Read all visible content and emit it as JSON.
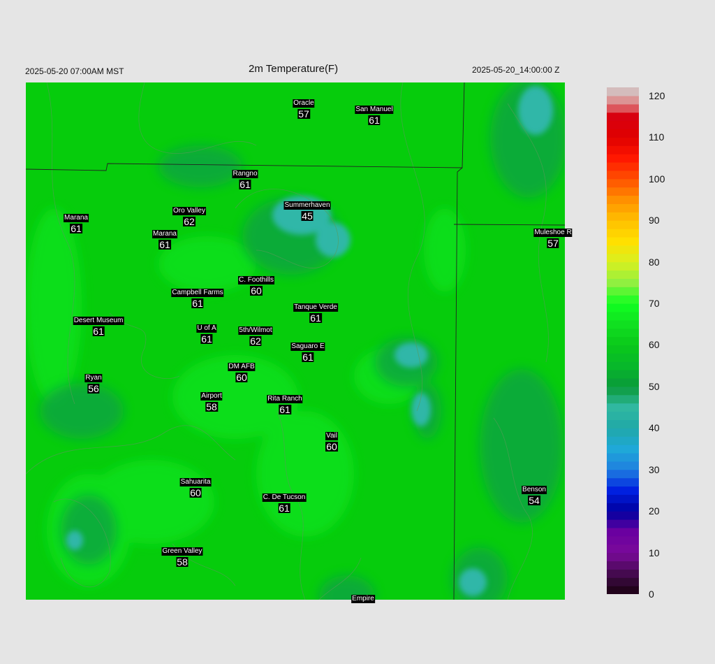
{
  "header": {
    "valid_time_local": "2025-05-20 07:00AM MST",
    "title": "2m Temperature(F)",
    "valid_time_utc": "2025-05-20_14:00:00 Z"
  },
  "colors": {
    "background": "#e5e5e5",
    "field_base": "#06cc0c",
    "field_warm": "#0fe01a",
    "field_cool": "#08a85a",
    "field_cold": "#2ab5b0",
    "boundary_line": "#222222",
    "label_box": "#000000",
    "label_text": "#ffffff"
  },
  "colorbar": {
    "min": 0,
    "max": 122,
    "ticks": [
      "120",
      "110",
      "100",
      "90",
      "80",
      "70",
      "60",
      "50",
      "40",
      "30",
      "20",
      "10",
      "0"
    ]
  },
  "stations": [
    {
      "name": "Oracle",
      "value": "57"
    },
    {
      "name": "San Manuel",
      "value": "61"
    },
    {
      "name": "Rangno",
      "value": "61"
    },
    {
      "name": "Summerhaven",
      "value": "45"
    },
    {
      "name": "Oro Valley",
      "value": "62"
    },
    {
      "name": "Marana",
      "value": "61"
    },
    {
      "name": "Marana",
      "value": "61"
    },
    {
      "name": "Muleshoe R",
      "value": "57"
    },
    {
      "name": "C. Foothills",
      "value": "60"
    },
    {
      "name": "Campbell Farms",
      "value": "61"
    },
    {
      "name": "Tanque Verde",
      "value": "61"
    },
    {
      "name": "Desert Museum",
      "value": "61"
    },
    {
      "name": "U of A",
      "value": "61"
    },
    {
      "name": "5th/Wilmot",
      "value": "62"
    },
    {
      "name": "Saguaro E",
      "value": "61"
    },
    {
      "name": "DM AFB",
      "value": "60"
    },
    {
      "name": "Ryan",
      "value": "56"
    },
    {
      "name": "Airport",
      "value": "58"
    },
    {
      "name": "Rita Ranch",
      "value": "61"
    },
    {
      "name": "Vail",
      "value": "60"
    },
    {
      "name": "Sahuarita",
      "value": "60"
    },
    {
      "name": "C. De Tucson",
      "value": "61"
    },
    {
      "name": "Benson",
      "value": "54"
    },
    {
      "name": "Green Valley",
      "value": "58"
    },
    {
      "name": "Empire",
      "value": ""
    }
  ]
}
